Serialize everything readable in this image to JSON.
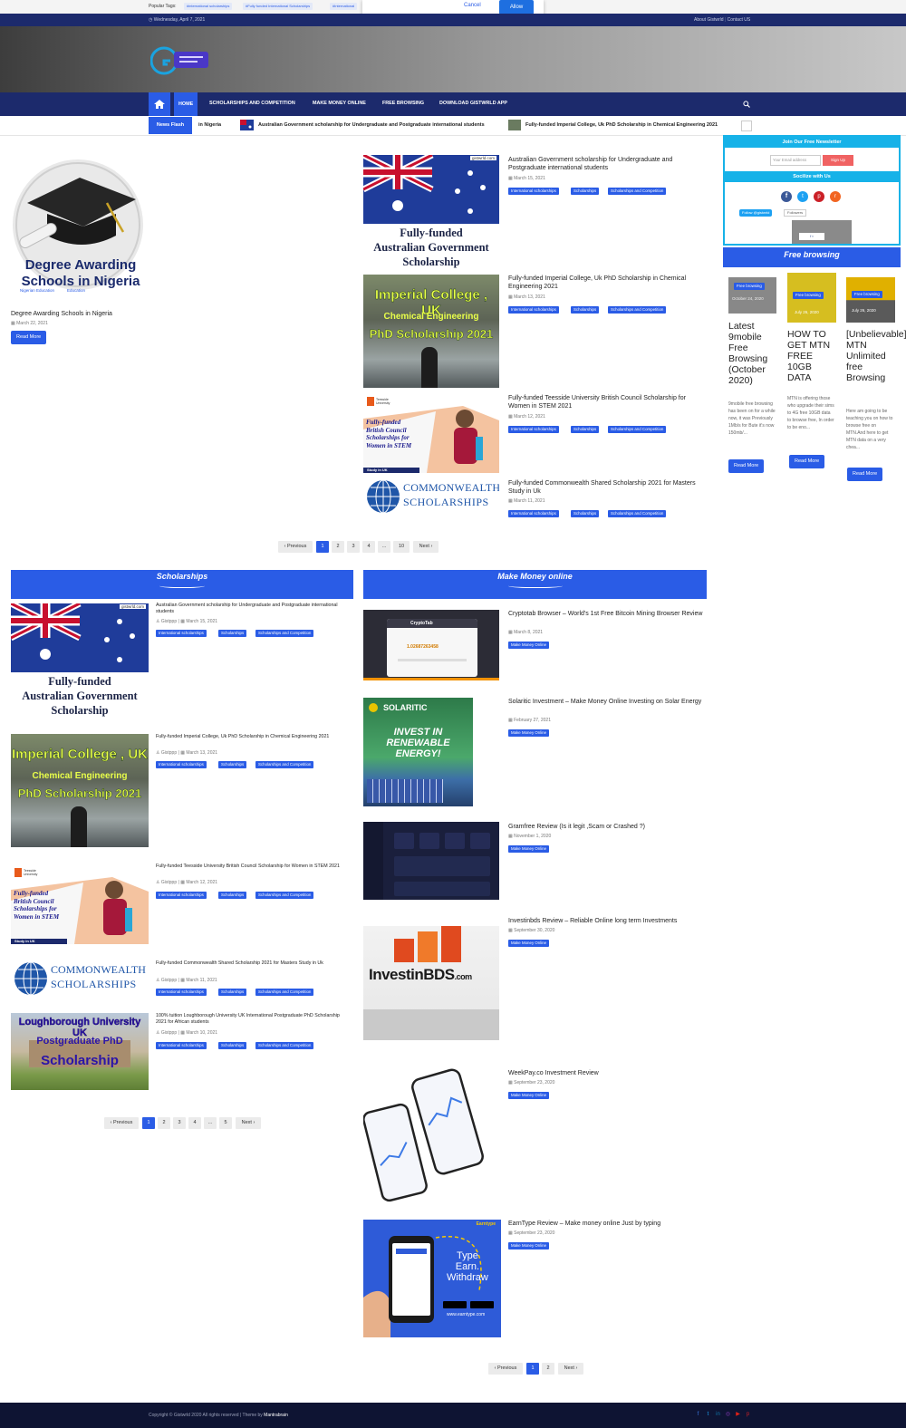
{
  "topbar": {
    "popular_label": "Popular Tags:",
    "tags": [
      "#international scholarships",
      "#Fully funded International Scholarships",
      "#International"
    ]
  },
  "notification_popup": {
    "cancel_label": "Cancel",
    "allow_label": "Allow"
  },
  "datebar": {
    "date": "Wednesday, April 7, 2021",
    "about": "About Gistwrld",
    "contact": "Contact US"
  },
  "nav": {
    "items": [
      "HOME",
      "SCHOLARSHIPS AND COMPETITION",
      "MAKE MONEY ONLINE",
      "FREE BROWSING",
      "DOWNLOAD GISTWRLD APP"
    ]
  },
  "ticker": {
    "label": "News Flash",
    "items": [
      "in Nigeria",
      "Australian Government scholarship for Undergraduate and Postgraduate international students",
      "Fully-funded Imperial College, Uk PhD Scholarship in Chemical Engineering 2021"
    ]
  },
  "featured": {
    "image_text": "Degree Awarding Schools in Nigeria",
    "image_cats": [
      "Nigerian Education",
      "Education"
    ],
    "title": "Degree Awarding Schools in Nigeria",
    "date": "March 22, 2021",
    "read_more": "Read More"
  },
  "top_posts": [
    {
      "title": "Australian Government scholarship for Undergraduate and Postgraduate international students",
      "date": "March 15, 2021",
      "image_text": [
        "Fully-funded",
        "Australian Government",
        "Scholarship"
      ],
      "brand": "gistwrld.com"
    },
    {
      "title": "Fully-funded Imperial College, Uk PhD Scholarship in Chemical Engineering 2021",
      "date": "March 13, 2021",
      "image_text": [
        "Imperial College , UK",
        "Chemical Engineering",
        "PhD Scholarship 2021"
      ]
    },
    {
      "title": "Fully-funded Teesside University British Council Scholarship for Women in STEM 2021",
      "date": "March 12, 2021",
      "image_text": [
        "Fully-funded",
        "British Council",
        "Scholarships for",
        "Women in STEM",
        "Study in UK"
      ],
      "brand": "Teesside University"
    },
    {
      "title": "Fully-funded Commonwealth Shared Scholarship 2021 for Masters Study in Uk",
      "date": "March 11, 2021",
      "image_text": [
        "COMMONWEALTH",
        "SCHOLARSHIPS"
      ]
    }
  ],
  "scholarship_cats": [
    "International scholarships",
    "Scholarships",
    "Scholarships and Competition"
  ],
  "pagination_top": [
    "‹ Previous",
    "1",
    "2",
    "3",
    "4",
    "...",
    "10",
    "Next ›"
  ],
  "sidebar": {
    "newsletter_title": "Join Our Free Newsletter",
    "email_placeholder": "Your Email address",
    "signup_label": "Sign Up",
    "follow_title": "Socilize with Us",
    "twitter_follow": "Follow @gistwrld",
    "followers": "Followers",
    "free_browsing_title": "Free browsing",
    "free_browsing_posts": [
      {
        "badge": "Free browsing",
        "title": "Latest 9mobile Free Browsing (October 2020)",
        "excerpt": "9mobile free browsing has been on for a while now, it was Previously 1Mb/s for Bute it's now 150mb/...",
        "img_date": "October 24, 2020"
      },
      {
        "badge": "Free browsing",
        "title": "HOW TO GET MTN FREE 10GB DATA",
        "excerpt": "MTN is offering those who upgrade their sims to 4G free 10GB data to browse free, In order to be eno...",
        "img_date": "July 26, 2020"
      },
      {
        "badge": "Free browsing",
        "title": "[Unbelievable]Latest MTN Unlimited free Browsing",
        "excerpt": "Here am going to be teaching you on how to browse free on MTN.And here to get MTN data on a very chea...",
        "img_date": "July 26, 2020"
      }
    ],
    "read_more": "Read More"
  },
  "scholarships_section": {
    "title": "Scholarships",
    "author": "Gistppp",
    "posts": [
      {
        "title": "Australian Government scholarship for Undergraduate and Postgraduate international students",
        "date": "March 15, 2021"
      },
      {
        "title": "Fully-funded Imperial College, Uk PhD Scholarship in Chemical Engineering 2021",
        "date": "March 13, 2021"
      },
      {
        "title": "Fully-funded Teesside University British Council Scholarship for Women in STEM 2021",
        "date": "March 12, 2021"
      },
      {
        "title": "Fully-funded Commonwealth Shared Scholarship 2021 for Masters Study in Uk",
        "date": "March 11, 2021"
      },
      {
        "title": "100% tuition Loughborough University UK International Postgraduate PhD Scholarship 2021 for African students",
        "date": "March 10, 2021",
        "image_text": [
          "Loughborough University UK",
          "Postgraduate PhD",
          "Scholarship"
        ]
      }
    ],
    "pagination": [
      "‹ Previous",
      "1",
      "2",
      "3",
      "4",
      "...",
      "5",
      "Next ›"
    ]
  },
  "money_section": {
    "title": "Make Money online",
    "cat": "Make Money Online",
    "posts": [
      {
        "title": "Cryptotab Browser – World's 1st Free Bitcoin Mining Browser Review",
        "date": "March 8, 2021",
        "image_text": [
          "CryptoTab",
          "1.02687263458"
        ]
      },
      {
        "title": "Solaritic Investment – Make Money Online Investing on Solar Energy",
        "date": "February 27, 2021",
        "image_text": [
          "SOLARITIC",
          "INVEST IN",
          "RENEWABLE",
          "ENERGY!"
        ]
      },
      {
        "title": "Gramfree Review (Is it legit ,Scam or Crashed ?)",
        "date": "November 1, 2020"
      },
      {
        "title": "Investinbds Review – Reliable Online long term Investments",
        "date": "September 30, 2020",
        "image_text": [
          "InvestinBDS",
          ".com"
        ]
      },
      {
        "title": "WeekPay.co Investment Review",
        "date": "September 23, 2020"
      },
      {
        "title": "EarnType Review – Make money online Just by typing",
        "date": "September 23, 2020",
        "image_text": [
          "Type",
          "Earn.",
          "Withdraw",
          "Earntype",
          "www.earntype.com"
        ]
      }
    ],
    "pagination": [
      "‹ Previous",
      "1",
      "2",
      "Next ›"
    ]
  },
  "footer": {
    "copyright": "Copyright © Gistwrld 2020 All rights reserved | Theme by",
    "theme_by": "Mantrabrain"
  }
}
